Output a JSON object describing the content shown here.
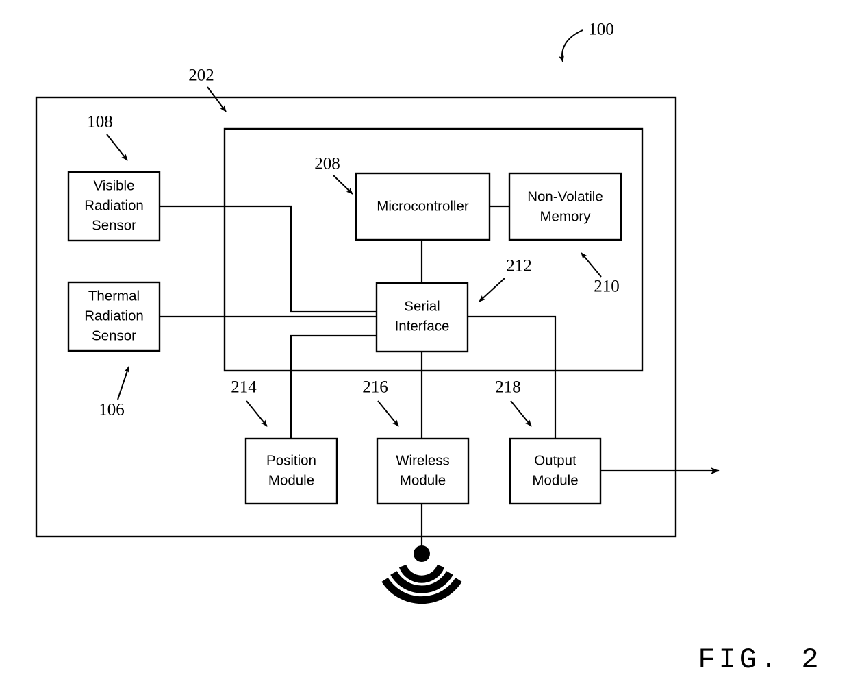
{
  "figure": {
    "caption": "FIG. 2",
    "system_ref": "100"
  },
  "containers": [
    {
      "id": "device",
      "ref": "100",
      "label": ""
    },
    {
      "id": "control-unit",
      "ref": "202",
      "label": ""
    },
    {
      "id": "processing-subsystem",
      "ref": "210",
      "label": ""
    }
  ],
  "blocks": {
    "visible_sensor": {
      "ref": "108",
      "line1": "Visible",
      "line2": "Radiation",
      "line3": "Sensor"
    },
    "thermal_sensor": {
      "ref": "106",
      "line1": "Thermal",
      "line2": "Radiation",
      "line3": "Sensor"
    },
    "microcontroller": {
      "ref": "208",
      "line1": "Microcontroller",
      "line2": "",
      "line3": ""
    },
    "memory": {
      "ref": "210",
      "line1": "Non-Volatile",
      "line2": "Memory",
      "line3": ""
    },
    "serial_interface": {
      "ref": "212",
      "line1": "Serial",
      "line2": "Interface",
      "line3": ""
    },
    "position_module": {
      "ref": "214",
      "line1": "Position",
      "line2": "Module",
      "line3": ""
    },
    "wireless_module": {
      "ref": "216",
      "line1": "Wireless",
      "line2": "Module",
      "line3": ""
    },
    "output_module": {
      "ref": "218",
      "line1": "Output",
      "line2": "Module",
      "line3": ""
    }
  },
  "reference_numerals": {
    "system": "100",
    "control_unit": "202",
    "sensor_module": "106",
    "visible_sensor": "108",
    "microcontroller": "208",
    "memory": "210",
    "serial_interface": "212",
    "position_module": "214",
    "wireless_module": "216",
    "output_module": "218"
  },
  "icons": {
    "antenna": "antenna-broadcast-icon",
    "output_arrow": "output-arrow-icon"
  },
  "colors": {
    "stroke": "#000000",
    "background": "#ffffff"
  }
}
